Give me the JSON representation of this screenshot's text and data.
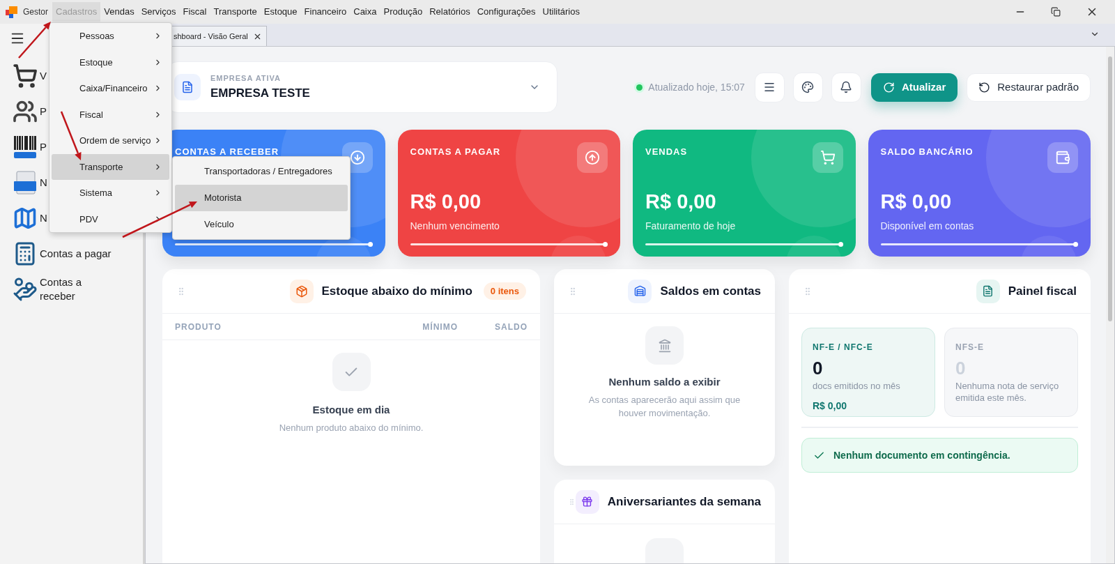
{
  "menu_bar": {
    "app_name": "Gestor",
    "items": [
      {
        "label": "Cadastros",
        "selected": true
      },
      {
        "label": "Vendas",
        "selected": false
      },
      {
        "label": "Serviços",
        "selected": false
      },
      {
        "label": "Fiscal",
        "selected": false
      },
      {
        "label": "Transporte",
        "selected": false
      },
      {
        "label": "Estoque",
        "selected": false
      },
      {
        "label": "Financeiro",
        "selected": false
      },
      {
        "label": "Caixa",
        "selected": false
      },
      {
        "label": "Produção",
        "selected": false
      },
      {
        "label": "Relatórios",
        "selected": false
      },
      {
        "label": "Configurações",
        "selected": false
      },
      {
        "label": "Utilitários",
        "selected": false
      }
    ]
  },
  "cadastros_menu": {
    "items": [
      {
        "label": "Pessoas",
        "selected": false
      },
      {
        "label": "Estoque",
        "selected": false
      },
      {
        "label": "Caixa/Financeiro",
        "selected": false
      },
      {
        "label": "Fiscal",
        "selected": false
      },
      {
        "label": "Ordem de serviço",
        "selected": false
      },
      {
        "label": "Transporte",
        "selected": true
      },
      {
        "label": "Sistema",
        "selected": false
      },
      {
        "label": "PDV",
        "selected": false
      }
    ]
  },
  "transporte_submenu": {
    "items": [
      {
        "label": "Transportadoras / Entregadores",
        "selected": false
      },
      {
        "label": "Motorista",
        "selected": true
      },
      {
        "label": "Veículo",
        "selected": false
      }
    ]
  },
  "sidebar": {
    "items": [
      {
        "kind": "cart",
        "label": "V"
      },
      {
        "kind": "people",
        "label": "P"
      },
      {
        "kind": "barcode",
        "label": "P"
      },
      {
        "kind": "nfse",
        "label": "N"
      },
      {
        "kind": "nfe",
        "label": "N"
      },
      {
        "kind": "payable",
        "label": "Contas a pagar"
      },
      {
        "kind": "receivable",
        "label": "Contas a receber"
      }
    ]
  },
  "tab": {
    "label": "shboard - Visão Geral"
  },
  "header": {
    "company_caption": "EMPRESA ATIVA",
    "company_name": "EMPRESA TESTE",
    "status": {
      "text": "Atualizado hoje, 15:07",
      "ok": true
    },
    "refresh_button": "Atualizar",
    "restore_button": "Restaurar padrão"
  },
  "stat_cards": [
    {
      "kind": "receivable",
      "title": "CONTAS A RECEBER",
      "color": "#3b82f6"
    },
    {
      "kind": "payable",
      "title": "CONTAS A PAGAR",
      "value": "R$ 0,00",
      "subtitle": "Nenhum vencimento",
      "color": "#ef4444"
    },
    {
      "kind": "sales",
      "title": "VENDAS",
      "value": "R$ 0,00",
      "subtitle": "Faturamento de hoje",
      "color": "#10b981"
    },
    {
      "kind": "bank",
      "title": "SALDO BANCÁRIO",
      "value": "R$ 0,00",
      "subtitle": "Disponível em contas",
      "color": "#6366f1"
    }
  ],
  "low_stock_panel": {
    "title": "Estoque abaixo do mínimo",
    "badge": "0 itens",
    "columns": [
      "PRODUTO",
      "MÍNIMO",
      "SALDO"
    ],
    "empty_title": "Estoque em dia",
    "empty_text": "Nenhum produto abaixo do mínimo."
  },
  "balances_panel": {
    "title": "Saldos em contas",
    "empty_title": "Nenhum saldo a exibir",
    "empty_text": "As contas aparecerão aqui assim que houver movimentação."
  },
  "birthdays_panel": {
    "title": "Aniversariantes da semana"
  },
  "fiscal_panel": {
    "title": "Painel fiscal",
    "boxes": [
      {
        "label": "NF-E / NFC-E",
        "count": "0",
        "caption": "docs emitidos no mês",
        "amount": "R$ 0,00",
        "active": true
      },
      {
        "label": "NFS-E",
        "count": "0",
        "caption": "Nenhuma nota de serviço emitida este mês.",
        "active": false
      }
    ],
    "alert": "Nenhum documento em contingência."
  }
}
